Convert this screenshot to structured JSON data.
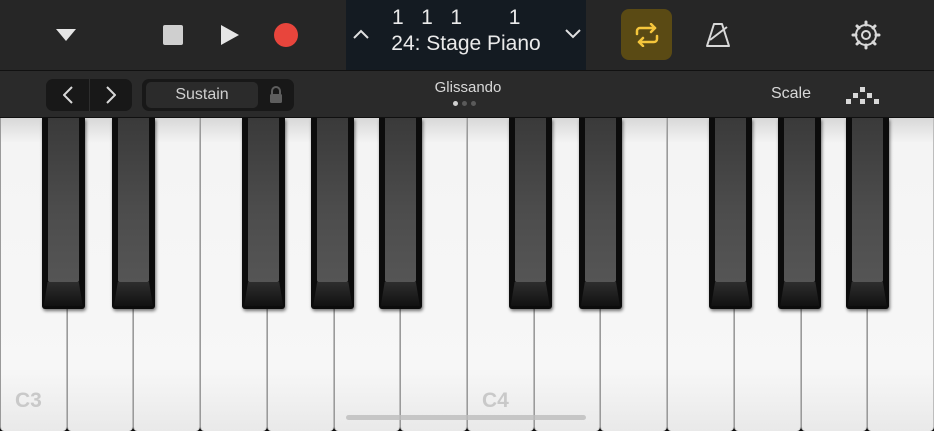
{
  "control_bar": {
    "lcd": {
      "position": "1   1   1        1",
      "instrument_name": "24: Stage Piano"
    },
    "loop_active": true,
    "colors": {
      "record": "#e8453c",
      "loop_accent": "#f5c63c",
      "loop_bg": "#5a4a14"
    },
    "icons": [
      "chevron-down-icon",
      "stop-icon",
      "play-icon",
      "record-icon",
      "chevron-up-icon",
      "chevron-down-icon",
      "loop-icon",
      "metronome-icon",
      "settings-icon"
    ]
  },
  "sub_bar": {
    "sustain_label": "Sustain",
    "mode_label": "Glissando",
    "page_dots": {
      "count": 3,
      "active": 1
    },
    "scale_label": "Scale"
  },
  "keyboard": {
    "white_keys": [
      {
        "note": "C3",
        "label": "C3"
      },
      {
        "note": "D3",
        "label": ""
      },
      {
        "note": "E3",
        "label": ""
      },
      {
        "note": "F3",
        "label": ""
      },
      {
        "note": "G3",
        "label": ""
      },
      {
        "note": "A3",
        "label": ""
      },
      {
        "note": "B3",
        "label": ""
      },
      {
        "note": "C4",
        "label": "C4"
      },
      {
        "note": "D4",
        "label": ""
      },
      {
        "note": "E4",
        "label": ""
      },
      {
        "note": "F4",
        "label": ""
      },
      {
        "note": "G4",
        "label": ""
      },
      {
        "note": "A4",
        "label": ""
      },
      {
        "note": "B4",
        "label": ""
      }
    ],
    "black_keys": [
      "C#3",
      "D#3",
      "F#3",
      "G#3",
      "A#3",
      "C#4",
      "D#4",
      "F#4",
      "G#4",
      "A#4"
    ]
  }
}
